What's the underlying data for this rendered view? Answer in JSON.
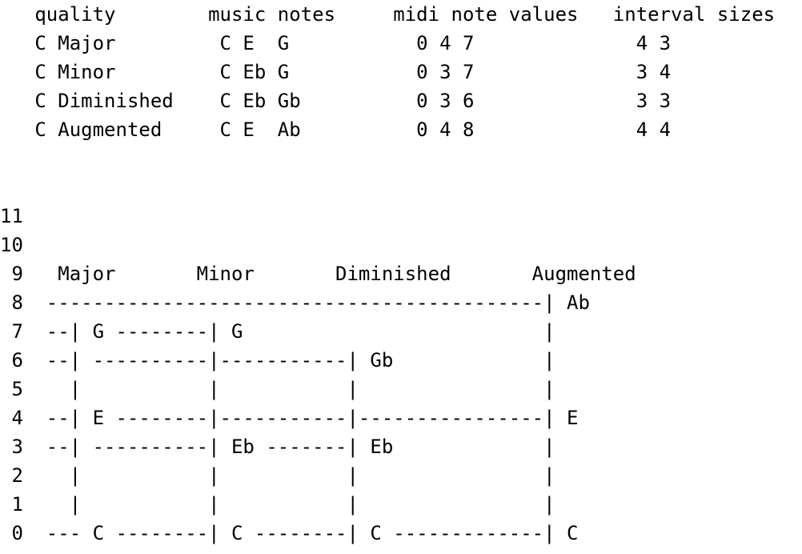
{
  "chord_table": {
    "lines": [
      "   quality        music notes     midi note values   interval sizes",
      "   C Major         C E  G           0 4 7              4 3",
      "   C Minor         C Eb G           0 3 7              3 4",
      "   C Diminished    C Eb Gb          0 3 6              3 3",
      "   C Augmented     C E  Ab          0 4 8              4 4"
    ]
  },
  "chord_diagram": {
    "lines": [
      "11",
      "10",
      " 9   Major       Minor       Diminished       Augmented",
      " 8  -------------------------------------------| Ab",
      " 7  --| G --------| G                          |",
      " 6  --| ----------|-----------| Gb             |",
      " 5    |           |           |                |",
      " 4  --| E --------|-----------|----------------| E",
      " 3  --| ----------| Eb -------| Eb             |",
      " 2    |           |           |                |",
      " 1    |           |           |                |",
      " 0  --- C --------| C --------| C -------------| C"
    ]
  }
}
